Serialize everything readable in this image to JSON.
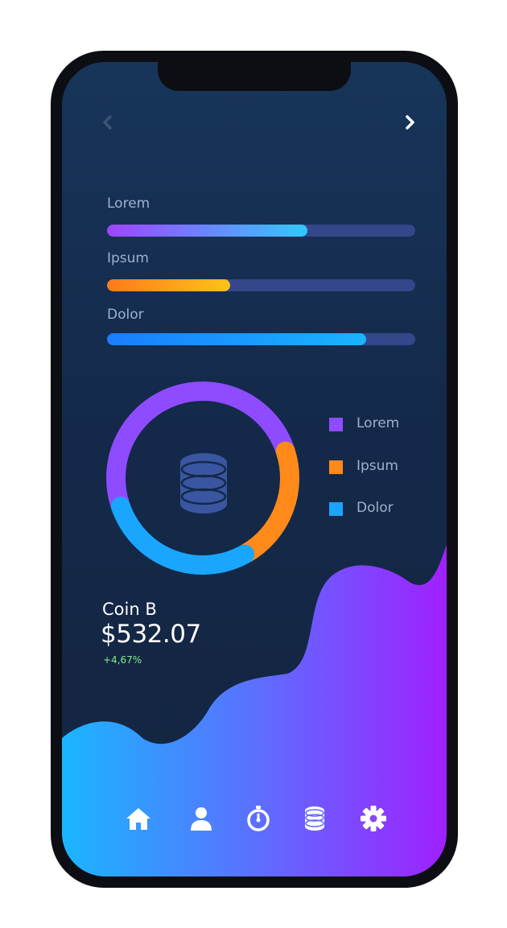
{
  "nav": {
    "prev_icon": "chevron-left-icon",
    "next_icon": "chevron-right-icon"
  },
  "bars": [
    {
      "label": "Lorem",
      "progress": 0.65,
      "colors": [
        "#a044ff",
        "#34c8ff"
      ]
    },
    {
      "label": "Ipsum",
      "progress": 0.4,
      "colors": [
        "#ff7a1a",
        "#ffc21a"
      ]
    },
    {
      "label": "Dolor",
      "progress": 0.84,
      "colors": [
        "#1a7dff",
        "#19b4ff"
      ]
    }
  ],
  "donut": {
    "center_icon": "coins-stack-icon",
    "segments": [
      {
        "name": "Lorem",
        "fraction": 0.5,
        "color": "#8f4bff"
      },
      {
        "name": "Ipsum",
        "fraction": 0.22,
        "color": "#ff8a1a"
      },
      {
        "name": "Dolor",
        "fraction": 0.28,
        "color": "#1aa5ff"
      }
    ]
  },
  "legend": [
    {
      "label": "Lorem",
      "color": "#8f4bff"
    },
    {
      "label": "Ipsum",
      "color": "#ff8a1a"
    },
    {
      "label": "Dolor",
      "color": "#1aa5ff"
    }
  ],
  "coin": {
    "name": "Coin B",
    "price": "$532.07",
    "change": "+4,67%"
  },
  "tabbar": [
    {
      "icon": "home-icon"
    },
    {
      "icon": "user-icon"
    },
    {
      "icon": "timer-icon"
    },
    {
      "icon": "coins-icon"
    },
    {
      "icon": "settings-icon"
    }
  ],
  "colors": {
    "background": "#14294a",
    "track": "#33478a",
    "wave_start": "#1ab6ff",
    "wave_end": "#a020ff",
    "positive": "#7ff08d"
  }
}
